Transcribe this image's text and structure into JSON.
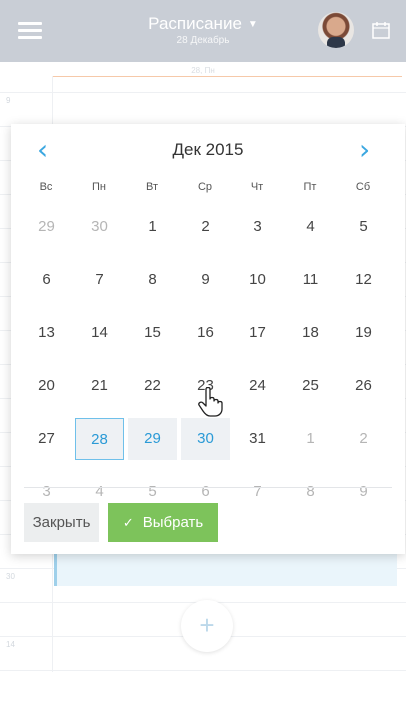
{
  "header": {
    "title": "Расписание",
    "subtitle": "28 Декабрь"
  },
  "schedule": {
    "date_label": "28, Пн",
    "hours": [
      "9",
      "",
      "",
      "",
      "",
      "",
      "",
      "",
      "",
      "",
      "",
      "",
      "",
      "",
      "30",
      "",
      "14",
      ""
    ]
  },
  "picker": {
    "month_label": "Дек 2015",
    "weekdays": [
      "Вс",
      "Пн",
      "Вт",
      "Ср",
      "Чт",
      "Пт",
      "Сб"
    ],
    "weeks": [
      [
        {
          "d": "29",
          "muted": true
        },
        {
          "d": "30",
          "muted": true
        },
        {
          "d": "1"
        },
        {
          "d": "2"
        },
        {
          "d": "3"
        },
        {
          "d": "4"
        },
        {
          "d": "5"
        }
      ],
      [
        {
          "d": "6"
        },
        {
          "d": "7"
        },
        {
          "d": "8"
        },
        {
          "d": "9"
        },
        {
          "d": "10"
        },
        {
          "d": "11"
        },
        {
          "d": "12"
        }
      ],
      [
        {
          "d": "13"
        },
        {
          "d": "14"
        },
        {
          "d": "15"
        },
        {
          "d": "16"
        },
        {
          "d": "17"
        },
        {
          "d": "18"
        },
        {
          "d": "19"
        }
      ],
      [
        {
          "d": "20"
        },
        {
          "d": "21"
        },
        {
          "d": "22"
        },
        {
          "d": "23"
        },
        {
          "d": "24"
        },
        {
          "d": "25"
        },
        {
          "d": "26"
        }
      ],
      [
        {
          "d": "27"
        },
        {
          "d": "28",
          "state": "selected"
        },
        {
          "d": "29",
          "state": "range"
        },
        {
          "d": "30",
          "state": "range"
        },
        {
          "d": "31"
        },
        {
          "d": "1",
          "muted": true
        },
        {
          "d": "2",
          "muted": true
        }
      ],
      [
        {
          "d": "3",
          "muted": true
        },
        {
          "d": "4",
          "muted": true
        },
        {
          "d": "5",
          "muted": true
        },
        {
          "d": "6",
          "muted": true
        },
        {
          "d": "7",
          "muted": true
        },
        {
          "d": "8",
          "muted": true
        },
        {
          "d": "9",
          "muted": true
        }
      ]
    ],
    "close_label": "Закрыть",
    "select_label": "Выбрать"
  },
  "colors": {
    "accent": "#3ba7e0",
    "confirm": "#7dc35b",
    "header": "#c9ced6"
  },
  "icons": [
    "menu-icon",
    "dropdown-caret-icon",
    "calendar-icon",
    "chevron-left-icon",
    "chevron-right-icon",
    "check-icon",
    "plus-icon",
    "hand-cursor-icon"
  ]
}
